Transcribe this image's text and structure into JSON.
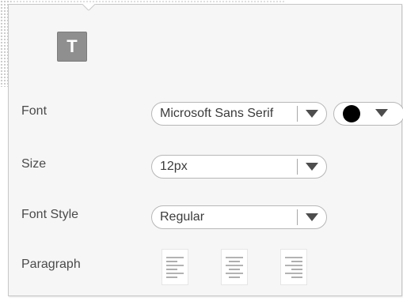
{
  "panel": {
    "text_tool": {
      "glyph": "T",
      "icon": "text-format-icon"
    },
    "rows": {
      "font": {
        "label": "Font",
        "value": "Microsoft Sans Serif",
        "color_swatch": "#000000"
      },
      "size": {
        "label": "Size",
        "value": "12px"
      },
      "style": {
        "label": "Font Style",
        "value": "Regular"
      },
      "paragraph": {
        "label": "Paragraph",
        "alignments": [
          "align-left-icon",
          "align-center-icon",
          "align-right-icon"
        ]
      }
    }
  },
  "colors": {
    "panel_bg": "#f6f6f6",
    "tool_bg": "#8f8f8f",
    "label_text": "#4a4a4a",
    "arrow": "#4d4d4d"
  }
}
